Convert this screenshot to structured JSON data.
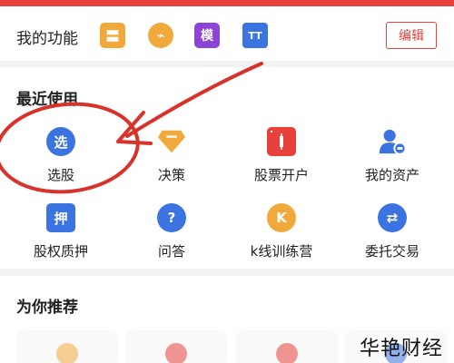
{
  "colors": {
    "accent": "#e8403a",
    "blue": "#3b73e0",
    "orange": "#f2a93b",
    "purple": "#8b44d6",
    "annotation_red": "#d8322b"
  },
  "my_functions": {
    "title": "我的功能",
    "edit_label": "编辑",
    "icons": [
      {
        "name": "strategy-icon",
        "glyph": "〓",
        "color": "#f2a93b"
      },
      {
        "name": "trend-icon",
        "glyph": "⌁",
        "color": "#f2a93b"
      },
      {
        "name": "simulation-icon",
        "glyph": "模",
        "color": "#8b44d6"
      },
      {
        "name": "text-tool-icon",
        "glyph": "TT",
        "color": "#3b73e0"
      }
    ]
  },
  "recent": {
    "title": "最近使用",
    "items": [
      {
        "label": "选股",
        "glyph": "选",
        "icon": "stock-pick-icon",
        "color": "#3b73e0",
        "shape": "round"
      },
      {
        "label": "决策",
        "glyph": "—",
        "icon": "decision-diamond-icon",
        "color": "#f2a93b",
        "shape": "diamond"
      },
      {
        "label": "股票开户",
        "glyph": "▮",
        "icon": "open-account-icon",
        "color": "#e8403a",
        "shape": "square"
      },
      {
        "label": "我的资产",
        "glyph": "●",
        "icon": "my-assets-icon",
        "color": "#3b73e0",
        "shape": "person"
      },
      {
        "label": "股权质押",
        "glyph": "押",
        "icon": "pledge-icon",
        "color": "#3b73e0",
        "shape": "square"
      },
      {
        "label": "问答",
        "glyph": "?",
        "icon": "qa-icon",
        "color": "#3b73e0",
        "shape": "round"
      },
      {
        "label": "k线训练营",
        "glyph": "K",
        "icon": "kline-training-icon",
        "color": "#f2a93b",
        "shape": "round"
      },
      {
        "label": "委托交易",
        "glyph": "⇄",
        "icon": "entrust-trade-icon",
        "color": "#3b73e0",
        "shape": "round"
      }
    ]
  },
  "recommend": {
    "title": "为你推荐",
    "cards": [
      {
        "icon": "recommend-card-icon",
        "color": "#f2a93b"
      },
      {
        "icon": "recommend-card-icon",
        "color": "#e8403a"
      },
      {
        "icon": "recommend-card-icon",
        "color": "#e8403a"
      },
      {
        "icon": "recommend-card-icon",
        "color": "#3b73e0"
      }
    ]
  },
  "watermark": "华艳财经"
}
